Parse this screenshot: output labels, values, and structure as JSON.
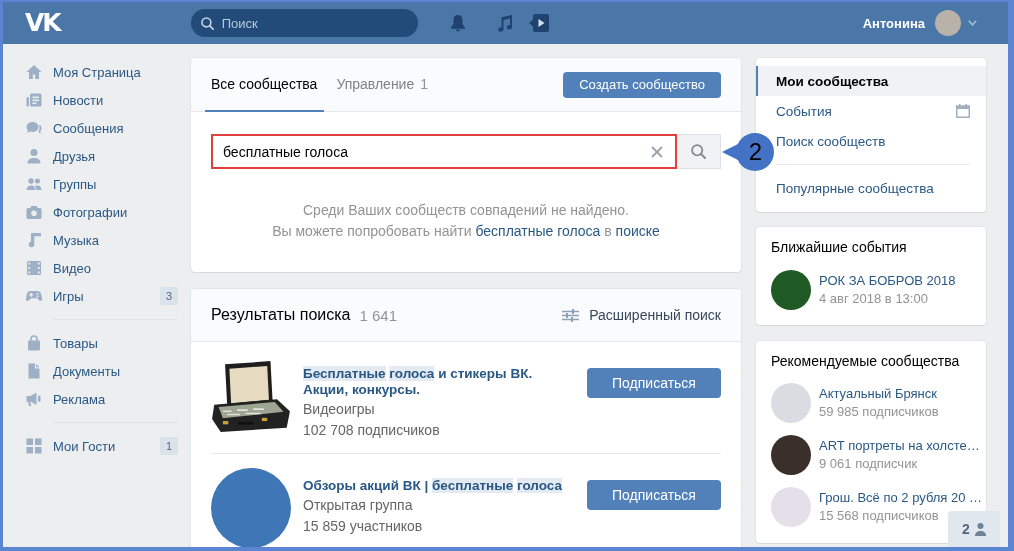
{
  "top_bar": {
    "logo": "VK",
    "search": {
      "placeholder": "Поиск"
    },
    "user_name": "Антонина"
  },
  "sidebar": {
    "groups": [
      {
        "items": [
          {
            "label": "Моя Страница"
          },
          {
            "label": "Новости"
          },
          {
            "label": "Сообщения"
          },
          {
            "label": "Друзья"
          },
          {
            "label": "Группы"
          },
          {
            "label": "Фотографии"
          },
          {
            "label": "Музыка"
          },
          {
            "label": "Видео"
          },
          {
            "label": "Игры",
            "badge": "3"
          }
        ]
      },
      {
        "items": [
          {
            "label": "Товары"
          },
          {
            "label": "Документы"
          },
          {
            "label": "Реклама"
          }
        ]
      },
      {
        "items": [
          {
            "label": "Мои Гости",
            "badge": "1"
          }
        ]
      }
    ]
  },
  "communities": {
    "tabs": [
      {
        "label": "Все сообщества",
        "selected": true
      },
      {
        "label": "Управление",
        "count": "1",
        "selected": false
      }
    ],
    "create_button": "Создать сообщество",
    "search": {
      "value": "бесплатные голоса",
      "highlighted": true
    },
    "no_results": "Среди Ваших сообществ совпадений не найдено.",
    "suggestion": {
      "before": "Вы можете попробовать найти",
      "query_link": "бесплатные голоса",
      "middle": "в",
      "search_link": "поиске"
    }
  },
  "callout": {
    "text": "2"
  },
  "results": {
    "title": "Результаты поиска",
    "count": "1 641",
    "advanced_search": "Расширенный поиск",
    "items": [
      {
        "title_parts": [
          {
            "text": "Бесплатные",
            "highlighted": true
          },
          {
            "text": "голоса",
            "highlighted": true
          },
          {
            "text": "и стикеры ВК. Акции, конкурсы.",
            "highlighted": false
          }
        ],
        "category": "Видеоигры",
        "members": "102 708 подписчиков",
        "button": "Подписаться"
      },
      {
        "title_parts": [
          {
            "text": "Обзоры акций ВК |",
            "highlighted": false
          },
          {
            "text": "бесплатные",
            "highlighted": true
          },
          {
            "text": "голоса",
            "highlighted": true
          }
        ],
        "category": "Открытая группа",
        "members": "15 859 участников",
        "button": "Подписаться"
      }
    ]
  },
  "communities_menu": {
    "groups": [
      {
        "items": [
          {
            "label": "Мои сообщества",
            "selected": true
          },
          {
            "label": "События",
            "selected": false
          },
          {
            "label": "Поиск сообществ",
            "selected": false
          }
        ]
      },
      {
        "items": [
          {
            "label": "Популярные сообщества",
            "selected": false
          }
        ]
      }
    ]
  },
  "upcoming_events": {
    "title": "Ближайшие события",
    "items": [
      {
        "name": "РОК ЗА БОБРОВ 2018",
        "date": "4 авг 2018 в 13:00"
      }
    ]
  },
  "recommended": {
    "title": "Рекомендуемые сообщества",
    "items": [
      {
        "name": "Актуальный Брянск",
        "members": "59 985 подписчиков"
      },
      {
        "name": "ART портреты на холсте…",
        "members": "9 061 подписчик"
      },
      {
        "name": "Грош. Всё по 2 рубля 20 …",
        "members": "15 568 подписчиков"
      }
    ]
  },
  "online_friends": {
    "count": "2"
  }
}
